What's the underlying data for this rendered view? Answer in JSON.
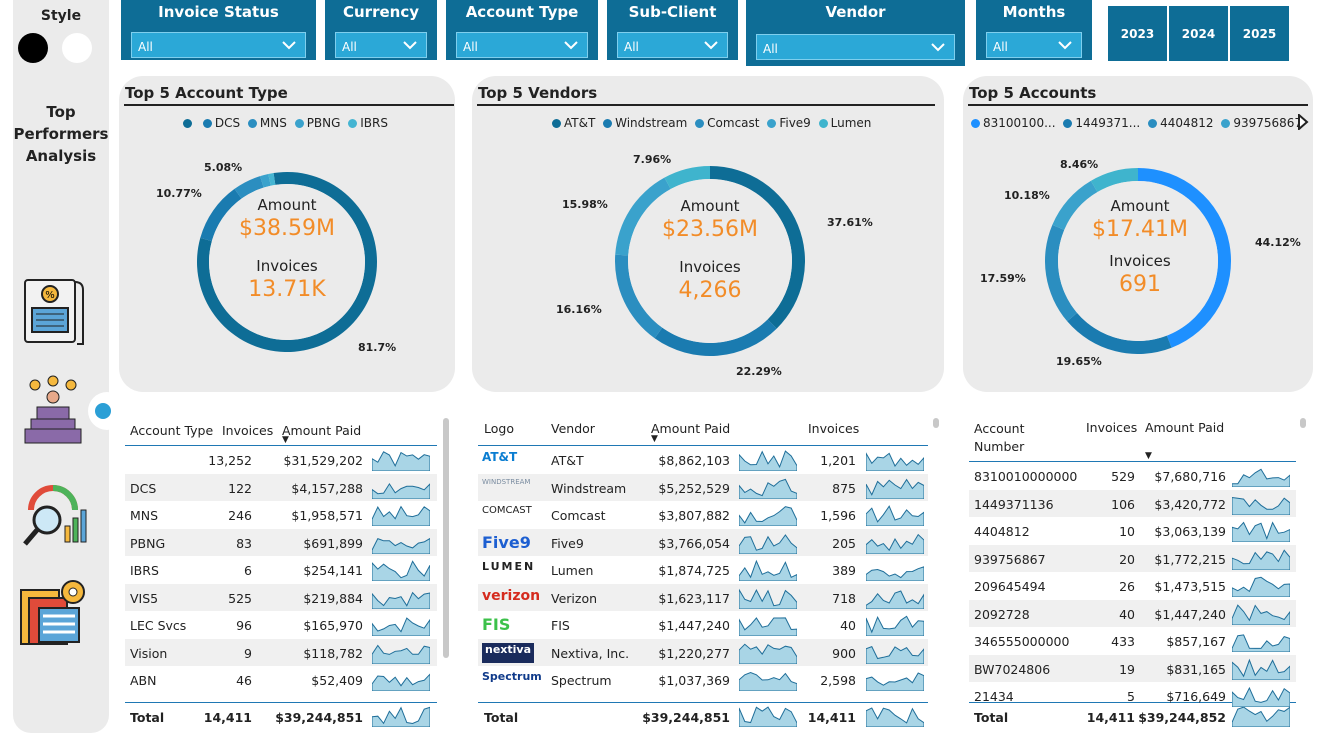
{
  "sidebar": {
    "style_label": "Style",
    "title": "Top Performers Analysis",
    "icons": [
      "invoice-percent-icon",
      "top-performers-podium-icon",
      "analytics-gauge-icon",
      "data-settings-icon"
    ]
  },
  "filters": [
    {
      "label": "Invoice Status",
      "value": "All"
    },
    {
      "label": "Currency",
      "value": "All"
    },
    {
      "label": "Account Type",
      "value": "All"
    },
    {
      "label": "Sub-Client",
      "value": "All"
    },
    {
      "label": "Vendor",
      "value": "All"
    },
    {
      "label": "Months",
      "value": "All"
    }
  ],
  "years": [
    "2023",
    "2024",
    "2025"
  ],
  "colors": {
    "navy": "#0e6d96",
    "orange": "#f28c28",
    "accent": "#2ba8d7"
  },
  "chart_data": [
    {
      "type": "pie",
      "title": "Top 5 Account Type",
      "categories": [
        "",
        "DCS",
        "MNS",
        "PBNG",
        "IBRS"
      ],
      "values": [
        81.7,
        10.77,
        5.08,
        1.5,
        0.95
      ],
      "value_labels": [
        "81.7%",
        "10.77%",
        "5.08%",
        "",
        ""
      ],
      "colors": [
        "#0e6d96",
        "#1a7bb0",
        "#2b8ec0",
        "#3aa2cc",
        "#45b5d2"
      ],
      "center": {
        "amount_label": "Amount",
        "amount": "$38.59M",
        "invoices_label": "Invoices",
        "invoices": "13.71K"
      }
    },
    {
      "type": "pie",
      "title": "Top 5 Vendors",
      "categories": [
        "AT&T",
        "Windstream",
        "Comcast",
        "Five9",
        "Lumen"
      ],
      "values": [
        37.61,
        22.29,
        16.16,
        15.98,
        7.96
      ],
      "value_labels": [
        "37.61%",
        "22.29%",
        "16.16%",
        "15.98%",
        "7.96%"
      ],
      "colors": [
        "#0e6d96",
        "#1a7bb0",
        "#2b8ec0",
        "#3aa2cc",
        "#3fb4cd"
      ],
      "center": {
        "amount_label": "Amount",
        "amount": "$23.56M",
        "invoices_label": "Invoices",
        "invoices": "4,266"
      }
    },
    {
      "type": "pie",
      "title": "Top 5 Accounts",
      "categories": [
        "83100100...",
        "1449371...",
        "4404812",
        "939756867"
      ],
      "values": [
        44.12,
        19.65,
        17.59,
        10.18,
        8.46
      ],
      "value_labels": [
        "44.12%",
        "19.65%",
        "17.59%",
        "10.18%",
        "8.46%"
      ],
      "colors": [
        "#1e90ff",
        "#1a7bb0",
        "#2b8ec0",
        "#3aa2cc",
        "#3fb4cd"
      ],
      "center": {
        "amount_label": "Amount",
        "amount": "$17.41M",
        "invoices_label": "Invoices",
        "invoices": "691"
      }
    }
  ],
  "account_table": {
    "headers": [
      "Account Type",
      "Invoices",
      "Amount Paid"
    ],
    "rows": [
      [
        "",
        "13,252",
        "$31,529,202"
      ],
      [
        "DCS",
        "122",
        "$4,157,288"
      ],
      [
        "MNS",
        "246",
        "$1,958,571"
      ],
      [
        "PBNG",
        "83",
        "$691,899"
      ],
      [
        "IBRS",
        "6",
        "$254,141"
      ],
      [
        "VIS5",
        "525",
        "$219,884"
      ],
      [
        "LEC Svcs",
        "96",
        "$165,970"
      ],
      [
        "Vision",
        "9",
        "$118,782"
      ],
      [
        "ABN",
        "46",
        "$52,409"
      ]
    ],
    "total": [
      "Total",
      "14,411",
      "$39,244,851"
    ]
  },
  "vendor_table": {
    "headers": [
      "Logo",
      "Vendor",
      "Amount Paid",
      "Invoices"
    ],
    "rows": [
      [
        "AT&T",
        "AT&T",
        "$8,862,103",
        "1,201"
      ],
      [
        "WINDSTREAM",
        "Windstream",
        "$5,252,529",
        "875"
      ],
      [
        "COMCAST",
        "Comcast",
        "$3,807,882",
        "1,596"
      ],
      [
        "Five9",
        "Five9",
        "$3,766,054",
        "205"
      ],
      [
        "LUMEN",
        "Lumen",
        "$1,874,725",
        "389"
      ],
      [
        "verizon",
        "Verizon",
        "$1,623,117",
        "718"
      ],
      [
        "FIS",
        "FIS",
        "$1,447,240",
        "40"
      ],
      [
        "nextiva",
        "Nextiva, Inc.",
        "$1,220,277",
        "900"
      ],
      [
        "Spectrum",
        "Spectrum",
        "$1,037,369",
        "2,598"
      ]
    ],
    "total": [
      "Total",
      "$39,244,851",
      "14,411"
    ]
  },
  "accounts_table": {
    "headers": [
      "Account Number",
      "Invoices",
      "Amount Paid"
    ],
    "rows": [
      [
        "8310010000000",
        "529",
        "$7,680,716"
      ],
      [
        "1449371136",
        "106",
        "$3,420,772"
      ],
      [
        "4404812",
        "10",
        "$3,063,139"
      ],
      [
        "939756867",
        "20",
        "$1,772,215"
      ],
      [
        "209645494",
        "26",
        "$1,473,515"
      ],
      [
        "2092728",
        "40",
        "$1,447,240"
      ],
      [
        "346555000000",
        "433",
        "$857,167"
      ],
      [
        "BW7024806",
        "19",
        "$831,165"
      ],
      [
        "21434",
        "5",
        "$716,649"
      ]
    ],
    "total": [
      "Total",
      "14,411",
      "$39,244,852"
    ]
  }
}
